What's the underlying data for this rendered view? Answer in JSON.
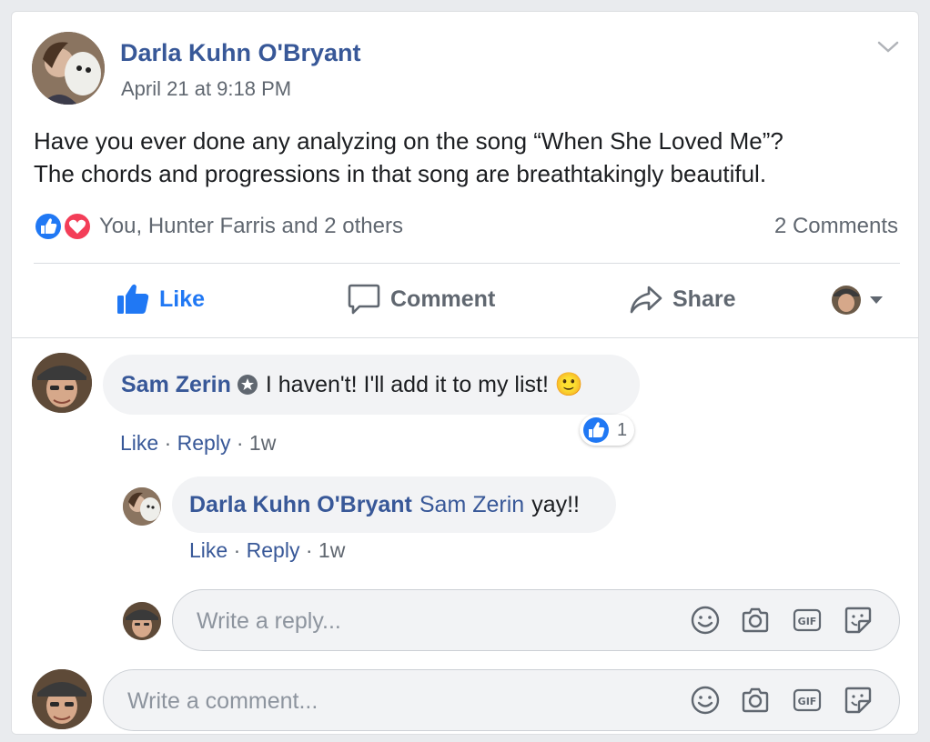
{
  "post": {
    "author": "Darla Kuhn O'Bryant",
    "timestamp": "April 21 at 9:18 PM",
    "text_line1": "Have you ever done any analyzing on the song “When She Loved Me”?",
    "text_line2": "The chords and progressions in that song are breathtakingly beautiful.",
    "reactions_text": "You, Hunter Farris and 2 others",
    "reaction_icons": [
      "like-icon",
      "love-icon"
    ],
    "comment_count": "2 Comments"
  },
  "actions": {
    "like": "Like",
    "comment": "Comment",
    "share": "Share"
  },
  "comments": [
    {
      "author": "Sam Zerin",
      "text": "I haven't! I'll add it to my list! 🙂",
      "like_label": "Like",
      "separator": "·",
      "reply_label": "Reply",
      "time": "1w",
      "reaction_count": "1"
    }
  ],
  "reply": {
    "author": "Darla Kuhn O'Bryant",
    "mention": "Sam Zerin",
    "text": "yay!!",
    "like_label": "Like",
    "separator": "·",
    "reply_label": "Reply",
    "time": "1w"
  },
  "reply_input": {
    "placeholder": "Write a reply..."
  },
  "comment_input": {
    "placeholder": "Write a comment..."
  },
  "colors": {
    "link": "#385898",
    "like_blue": "#2078f4",
    "love_red": "#f33e58",
    "muted": "#606770",
    "bubble_bg": "#f2f3f5"
  }
}
